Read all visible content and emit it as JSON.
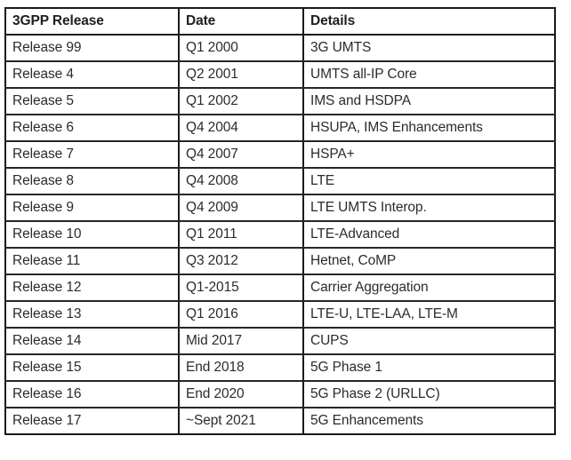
{
  "table": {
    "columns": [
      "3GPP Release",
      "Date",
      "Details"
    ],
    "rows": [
      {
        "release": "Release 99",
        "date": "Q1 2000",
        "details": "3G UMTS"
      },
      {
        "release": "Release 4",
        "date": "Q2 2001",
        "details": "UMTS all-IP Core"
      },
      {
        "release": "Release 5",
        "date": "Q1 2002",
        "details": "IMS and HSDPA"
      },
      {
        "release": "Release 6",
        "date": "Q4 2004",
        "details": "HSUPA, IMS Enhancements"
      },
      {
        "release": "Release 7",
        "date": "Q4 2007",
        "details": "HSPA+"
      },
      {
        "release": "Release 8",
        "date": "Q4 2008",
        "details": "LTE"
      },
      {
        "release": "Release 9",
        "date": "Q4 2009",
        "details": "LTE UMTS Interop."
      },
      {
        "release": "Release 10",
        "date": "Q1 2011",
        "details": "LTE-Advanced"
      },
      {
        "release": "Release 11",
        "date": "Q3 2012",
        "details": "Hetnet, CoMP"
      },
      {
        "release": "Release 12",
        "date": "Q1-2015",
        "details": "Carrier Aggregation"
      },
      {
        "release": "Release 13",
        "date": "Q1 2016",
        "details": "LTE-U, LTE-LAA, LTE-M"
      },
      {
        "release": "Release 14",
        "date": "Mid 2017",
        "details": "CUPS"
      },
      {
        "release": "Release 15",
        "date": "End 2018",
        "details": "5G Phase 1"
      },
      {
        "release": "Release 16",
        "date": "End 2020",
        "details": "5G Phase 2 (URLLC)"
      },
      {
        "release": "Release 17",
        "date": "~Sept 2021",
        "details": "5G Enhancements"
      }
    ]
  },
  "colors": {
    "border": "#1a1a1a",
    "text": "#2b2b2b",
    "background": "#ffffff"
  }
}
